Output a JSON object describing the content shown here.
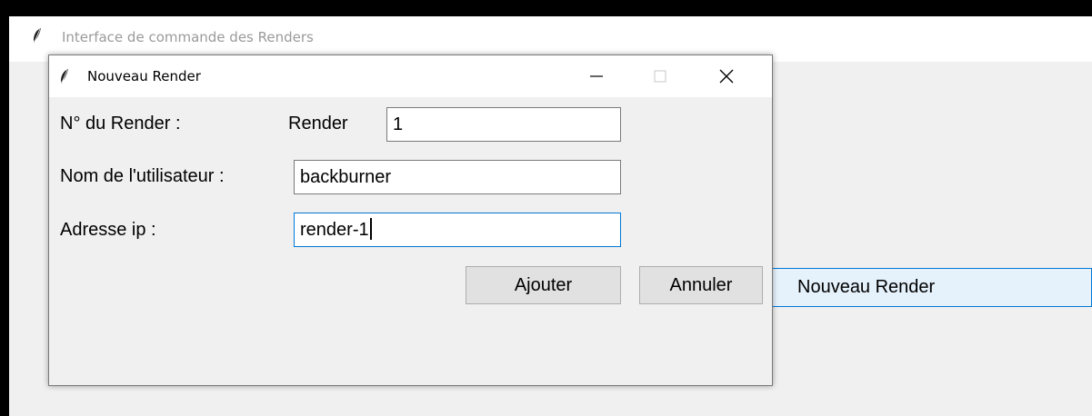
{
  "main_window": {
    "title": "Interface de commande des Renders",
    "nouveau_render_button": "Nouveau Render"
  },
  "dialog": {
    "title": "Nouveau Render",
    "fields": {
      "render_number": {
        "label": "N° du Render :",
        "prefix": "Render",
        "value": "1"
      },
      "username": {
        "label": "Nom de l'utilisateur :",
        "value": "backburner"
      },
      "ip_address": {
        "label": "Adresse ip :",
        "value": "render-1"
      }
    },
    "buttons": {
      "add": "Ajouter",
      "cancel": "Annuler"
    }
  },
  "icons": {
    "app": "feather-icon",
    "minimize": "minimize-icon",
    "maximize": "maximize-icon",
    "close": "close-icon"
  },
  "colors": {
    "focus_border": "#0078d7",
    "highlight_bg": "#e5f1fb"
  }
}
